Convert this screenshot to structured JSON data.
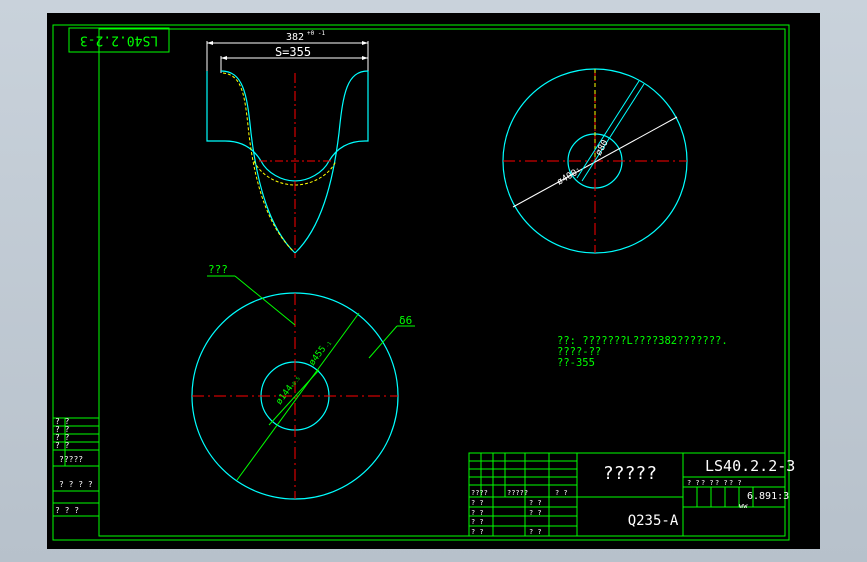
{
  "drawing": {
    "drawing_number": "LS40.2.2-3",
    "drawing_number_rotated": "LS40.2.2-3",
    "part_name": "?????",
    "material": "Q235-A",
    "scale": "6.891:3"
  },
  "profile_view": {
    "dim_top": "382",
    "dim_top_tol": "+0 -1",
    "dim_s": "S=355"
  },
  "ring_view": {
    "dim_outer": "ø400",
    "dim_outer_tol": "-1",
    "dim_inner": "ø80",
    "dim_inner_tol": ""
  },
  "blank_view": {
    "leader_label": "???",
    "thickness_label": "δ6",
    "dim_outer": "ø455",
    "dim_outer_tol": "-1",
    "dim_inner": "ø144",
    "dim_inner_tol": "+0.5"
  },
  "notes": {
    "line1": "??: ???????L????382???????.",
    "line2": "????-??",
    "line3": "??-355"
  },
  "title_block": {
    "row_labels": [
      "????",
      "?????",
      "? ?",
      "? ?",
      "? ?"
    ],
    "sign_labels": [
      "? ?",
      "? ?",
      "? ?",
      "? ?",
      "? ?"
    ],
    "weight_labels": [
      "? ?",
      "? ?",
      "? ?",
      "? ?"
    ],
    "ww": "ww"
  },
  "left_strip": {
    "labels": [
      "? ?",
      "? ?",
      "? ?",
      "? ?",
      "?????",
      "? ? ? ?",
      "? ? ?",
      "? ? ?"
    ]
  },
  "colors": {
    "border": "#00ff00",
    "outline": "#00ffff",
    "hidden": "#ffff00",
    "center": "#ff0000",
    "dimension": "#ffffff",
    "note": "#00ff00"
  }
}
